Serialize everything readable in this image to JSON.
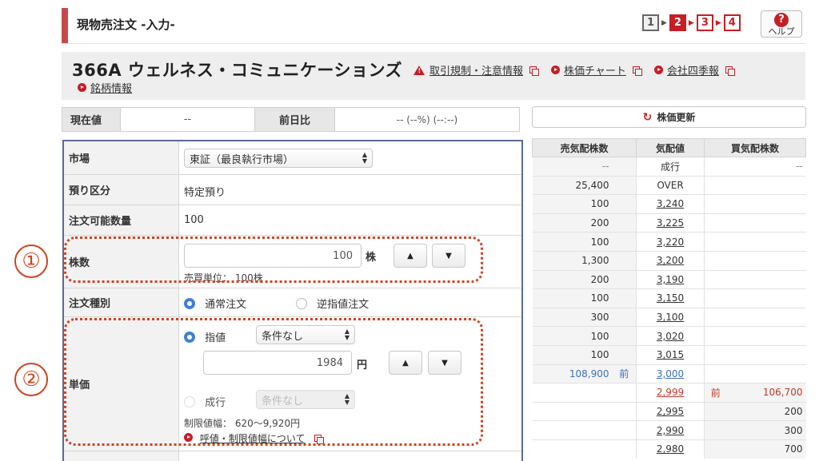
{
  "header": {
    "title": "現物売注文 -入力-",
    "steps": [
      "1",
      "2",
      "3",
      "4"
    ],
    "help_icon": "?",
    "help_label": "ヘルプ"
  },
  "stock": {
    "name": "366A ウェルネス・コミュニケーションズ",
    "links": [
      "取引規制・注意情報",
      "株価チャート",
      "会社四季報"
    ],
    "link_second_row": "銘柄情報"
  },
  "price_row": {
    "current_label": "現在値",
    "current_value": "--",
    "change_label": "前日比",
    "change_value": "-- (--%) (--:--)"
  },
  "refresh_label": "株価更新",
  "form": {
    "market_label": "市場",
    "market_value": "東証（最良執行市場）",
    "deposit_label": "預り区分",
    "deposit_value": "特定預り",
    "orderable_label": "注文可能数量",
    "orderable_value": "100",
    "qty_label": "株数",
    "qty_value": "100",
    "qty_unit": "株",
    "qty_note": "売買単位： 100株",
    "order_type_label": "注文種別",
    "order_type_options": [
      "通常注文",
      "逆指値注文"
    ],
    "price_label": "単価",
    "limit_label": "指値",
    "limit_condition": "条件なし",
    "price_value": "1984",
    "price_unit": "円",
    "market_order_label": "成行",
    "market_condition": "条件なし",
    "price_range": "制限値幅： 620〜9,920円",
    "price_range_link": "呼値・制限値幅について"
  },
  "annotations": [
    "①",
    "②"
  ],
  "order_book": {
    "headers": [
      "売気配株数",
      "気配値",
      "買気配株数"
    ],
    "rows": [
      {
        "sell": "--",
        "sell_mark": "",
        "price": "成行",
        "buy_mark": "",
        "buy": "--",
        "side": "sell"
      },
      {
        "sell": "25,400",
        "sell_mark": "",
        "price": "OVER",
        "buy_mark": "",
        "buy": "",
        "side": "sell"
      },
      {
        "sell": "100",
        "sell_mark": "",
        "price": "3,240",
        "buy_mark": "",
        "buy": "",
        "side": "sell"
      },
      {
        "sell": "200",
        "sell_mark": "",
        "price": "3,225",
        "buy_mark": "",
        "buy": "",
        "side": "sell"
      },
      {
        "sell": "100",
        "sell_mark": "",
        "price": "3,220",
        "buy_mark": "",
        "buy": "",
        "side": "sell"
      },
      {
        "sell": "1,300",
        "sell_mark": "",
        "price": "3,200",
        "buy_mark": "",
        "buy": "",
        "side": "sell"
      },
      {
        "sell": "200",
        "sell_mark": "",
        "price": "3,190",
        "buy_mark": "",
        "buy": "",
        "side": "sell"
      },
      {
        "sell": "100",
        "sell_mark": "",
        "price": "3,150",
        "buy_mark": "",
        "buy": "",
        "side": "sell"
      },
      {
        "sell": "300",
        "sell_mark": "",
        "price": "3,100",
        "buy_mark": "",
        "buy": "",
        "side": "sell"
      },
      {
        "sell": "100",
        "sell_mark": "",
        "price": "3,020",
        "buy_mark": "",
        "buy": "",
        "side": "sell"
      },
      {
        "sell": "100",
        "sell_mark": "",
        "price": "3,015",
        "buy_mark": "",
        "buy": "",
        "side": "sell"
      },
      {
        "sell": "108,900",
        "sell_mark": "前",
        "price": "3,000",
        "buy_mark": "",
        "buy": "",
        "side": "sell"
      },
      {
        "sell": "",
        "sell_mark": "",
        "price": "2,999",
        "buy_mark": "前",
        "buy": "106,700",
        "side": "buy"
      },
      {
        "sell": "",
        "sell_mark": "",
        "price": "2,995",
        "buy_mark": "",
        "buy": "200",
        "side": "buy"
      },
      {
        "sell": "",
        "sell_mark": "",
        "price": "2,990",
        "buy_mark": "",
        "buy": "300",
        "side": "buy"
      },
      {
        "sell": "",
        "sell_mark": "",
        "price": "2,980",
        "buy_mark": "",
        "buy": "700",
        "side": "buy"
      }
    ]
  }
}
